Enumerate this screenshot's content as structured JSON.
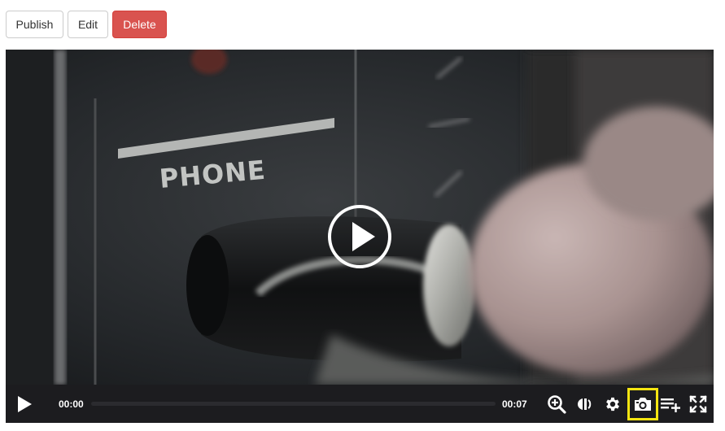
{
  "toolbar": {
    "publish_label": "Publish",
    "edit_label": "Edit",
    "delete_label": "Delete",
    "delete_color": "#d9534f"
  },
  "video": {
    "frame_text": "PHONE"
  },
  "player": {
    "current_time": "00:00",
    "duration": "00:07",
    "progress_fraction": 0,
    "icons": {
      "big_play": "play-circle-icon",
      "play": "play-icon",
      "zoom": "zoom-in-icon",
      "audio": "audio-description-icon",
      "settings": "gear-icon",
      "snapshot": "camera-icon",
      "playlist": "playlist-add-icon",
      "fullscreen": "fullscreen-icon"
    },
    "highlight_color": "#f5e511"
  }
}
